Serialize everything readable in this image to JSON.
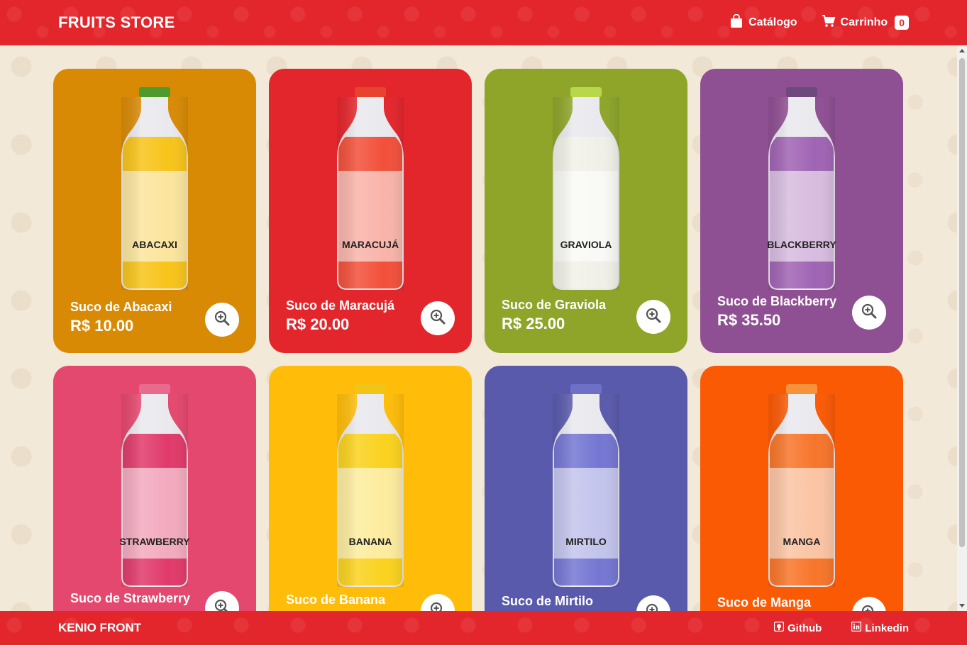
{
  "header": {
    "brand": "FRUITS STORE",
    "catalog_label": "Catálogo",
    "cart_label": "Carrinho",
    "cart_count": "0"
  },
  "products": [
    {
      "name": "Suco de Abacaxi",
      "price": "R$ 10.00",
      "label": "ABACAXI",
      "color": "#d98a05",
      "juice": "#f7c41a",
      "cap": "#4e9a2a"
    },
    {
      "name": "Suco de Maracujá",
      "price": "R$ 20.00",
      "label": "MARACUJÁ",
      "color": "#e3262c",
      "juice": "#f2503a",
      "cap": "#e8432f"
    },
    {
      "name": "Suco de Graviola",
      "price": "R$ 25.00",
      "label": "GRAVIOLA",
      "color": "#8ea52a",
      "juice": "#f1f0e8",
      "cap": "#b8d84a"
    },
    {
      "name": "Suco de Blackberry",
      "price": "R$ 35.50",
      "label": "BLACKBERRY",
      "color": "#8f4f93",
      "juice": "#a064b4",
      "cap": "#6e4a7c"
    },
    {
      "name": "Suco de Strawberry",
      "price": "",
      "label": "STRAWBERRY",
      "color": "#e5486e",
      "juice": "#e13a6a",
      "cap": "#e86a8c"
    },
    {
      "name": "Suco de Banana",
      "price": "",
      "label": "BANANA",
      "color": "#ffbd0a",
      "juice": "#fad21e",
      "cap": "#f2c418"
    },
    {
      "name": "Suco de Mirtilo",
      "price": "",
      "label": "MIRTILO",
      "color": "#5a5aad",
      "juice": "#7476d2",
      "cap": "#6e70c8"
    },
    {
      "name": "Suco de Manga",
      "price": "",
      "label": "MANGA",
      "color": "#fb5a05",
      "juice": "#f7752a",
      "cap": "#f5923a"
    }
  ],
  "footer": {
    "brand": "KENIO FRONT",
    "github_label": "Github",
    "linkedin_label": "Linkedin"
  },
  "icons": {
    "catalog": "shopping-bag-icon",
    "cart": "cart-icon",
    "zoom": "zoom-in-icon",
    "github": "github-icon",
    "linkedin": "linkedin-icon"
  }
}
